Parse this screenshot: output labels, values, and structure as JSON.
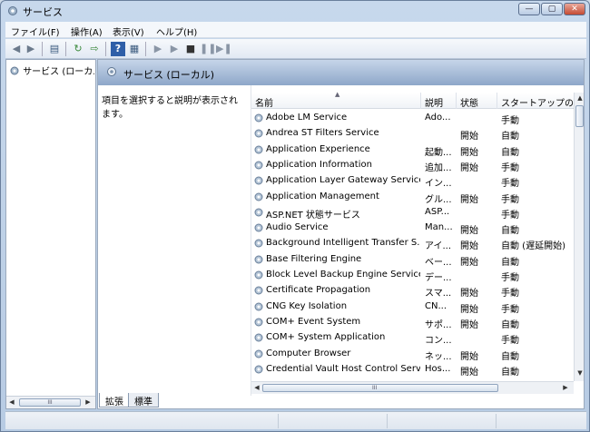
{
  "window": {
    "title": "サービス"
  },
  "window_buttons": {
    "min": "—",
    "max": "▢",
    "close": "✕"
  },
  "menu": [
    "ファイル(F)",
    "操作(A)",
    "表示(V)",
    "ヘルプ(H)"
  ],
  "toolbar_icons": [
    "back-arrow-icon",
    "forward-arrow-icon",
    "console-tree-icon",
    "refresh-icon",
    "export-icon",
    "help-icon",
    "properties-icon",
    "start-service-icon",
    "start-service-alt-icon",
    "stop-service-icon",
    "pause-service-icon",
    "restart-service-icon"
  ],
  "tree": {
    "item": "サービス (ローカル)"
  },
  "panel": {
    "title": "サービス (ローカル)",
    "description": "項目を選択すると説明が表示されます。"
  },
  "columns": {
    "name": "名前",
    "description": "説明",
    "status": "状態",
    "startup": "スタートアップの種"
  },
  "services": [
    {
      "name": "Adobe LM Service",
      "description": "Ado...",
      "status": "",
      "startup": "手動"
    },
    {
      "name": "Andrea ST Filters Service",
      "description": "",
      "status": "開始",
      "startup": "自動"
    },
    {
      "name": "Application Experience",
      "description": "起動...",
      "status": "開始",
      "startup": "自動"
    },
    {
      "name": "Application Information",
      "description": "追加...",
      "status": "開始",
      "startup": "手動"
    },
    {
      "name": "Application Layer Gateway Service",
      "description": "イン...",
      "status": "",
      "startup": "手動"
    },
    {
      "name": "Application Management",
      "description": "グル...",
      "status": "開始",
      "startup": "手動"
    },
    {
      "name": "ASP.NET 状態サービス",
      "description": "ASP...",
      "status": "",
      "startup": "手動"
    },
    {
      "name": "Audio Service",
      "description": "Man...",
      "status": "開始",
      "startup": "自動"
    },
    {
      "name": "Background Intelligent Transfer S...",
      "description": "アイ...",
      "status": "開始",
      "startup": "自動 (遅延開始)"
    },
    {
      "name": "Base Filtering Engine",
      "description": "ベー...",
      "status": "開始",
      "startup": "自動"
    },
    {
      "name": "Block Level Backup Engine Service",
      "description": "デー...",
      "status": "",
      "startup": "手動"
    },
    {
      "name": "Certificate Propagation",
      "description": "スマ...",
      "status": "開始",
      "startup": "手動"
    },
    {
      "name": "CNG Key Isolation",
      "description": "CN...",
      "status": "開始",
      "startup": "手動"
    },
    {
      "name": "COM+ Event System",
      "description": "サポ...",
      "status": "開始",
      "startup": "自動"
    },
    {
      "name": "COM+ System Application",
      "description": "コン...",
      "status": "",
      "startup": "手動"
    },
    {
      "name": "Computer Browser",
      "description": "ネッ...",
      "status": "開始",
      "startup": "自動"
    },
    {
      "name": "Credential Vault Host Control Serv...",
      "description": "Hos...",
      "status": "開始",
      "startup": "自動"
    }
  ],
  "scroll": {
    "up": "▲",
    "down": "▼",
    "left": "◀",
    "right": "▶",
    "grip": "III"
  },
  "tabs": [
    "拡張",
    "標準"
  ],
  "colors": {
    "title_gradient_top": "#c7d8ec",
    "panel_header": "#8ea7c9",
    "close_button": "#c44a32"
  }
}
